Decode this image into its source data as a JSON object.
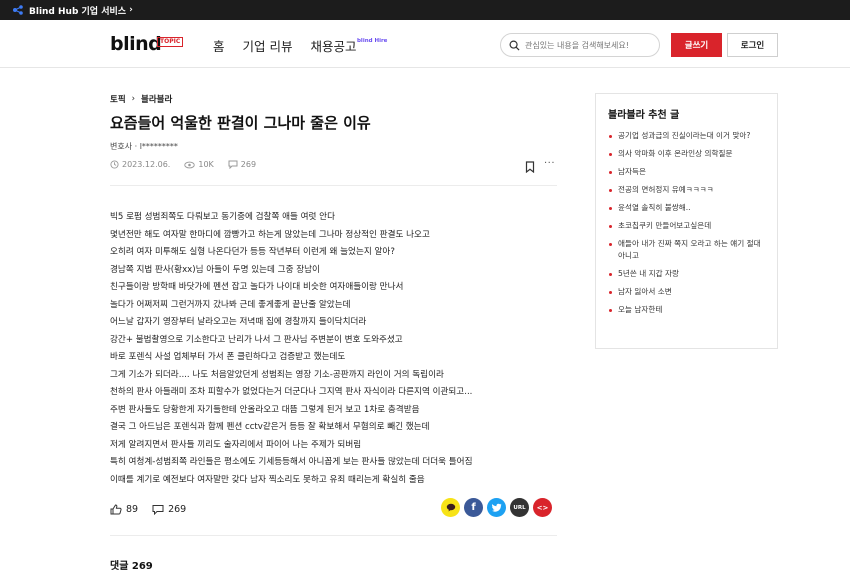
{
  "topbar": {
    "label": "Blind Hub 기업 서비스",
    "chevron": "›"
  },
  "header": {
    "logo": "blind",
    "logo_badge": "TOPIC",
    "nav": [
      "홈",
      "기업 리뷰",
      "채용공고"
    ],
    "nav_hire_badge": "blind Hire",
    "search_placeholder": "관심있는 내용을 검색해보세요!",
    "write_label": "글쓰기",
    "login_label": "로그인"
  },
  "post": {
    "breadcrumb": [
      "토픽",
      "블라블라"
    ],
    "title": "요즘들어 억울한 판결이 그나마 줄은 이유",
    "author": "변호사 · l*********",
    "date": "2023.12.06.",
    "views": "10K",
    "comments_count": "269",
    "lines": [
      "빅5 로펌 성범죄쪽도 다뤄보고 동기중에 검찰쪽 애들 여럿 안다",
      "몇년전만 해도 여자말 한마디에 깜빵가고 하는게 많았는데 그나마 정상적인 판결도 나오고",
      "오히려 여자 미투해도 실형 나온다던가 등등 작년부터 이런게 왜 늘었는지 알아?",
      "경남쪽 지법 판사(황xx)님 아들이 두명 있는데 그중 장남이",
      "친구들이랑 방학때 바닷가에 펜션 잡고 놀다가 나이대 비슷한 여자애들이랑 만나서",
      "놀다가 어쩌저찌 그런거까지 갔나봐 근데 좋게좋게 끝난줄 알았는데",
      "어느날 갑자기 영장부터 날라오고는 저녁때 집에 경찰까지 들이닥치더라",
      "강간+ 불법촬영으로 기소한다고 난리가 나서 그 판사님 주변분이 변호 도와주셨고",
      "바로 포렌식 사설 업체부터 가서 폰 클린하다고 검증받고 했는데도",
      "그게 기소가 되더라.... 나도 처음알았던게 성범죄는 영장 기소-공판까지 라인이 거의 독립이라",
      "천하의 판사 아들래미 조차 피할수가 없었다는거 더군다나 그지역 판사 자식이라 다른지역 이관되고...",
      "주변 판사들도 당황한게 자기들한테 안올라오고 대뜸 그렇게 된거 보고 1차로 충격받음",
      "결국 그 아드님은 포렌식과 함께 펜션 cctv같은거 등등 잘 확보해서 무혐의로 빼긴 했는데",
      "저게 알려지면서 판사들 끼리도 술자리에서 파이어 나는 주제가 되버림",
      "특히 여청계-성범죄쪽 라인들은 평소에도 기세등등해서 아니꼽게 보는 판사들 많았는데 더더욱 틀어짐",
      "이때를 계기로 예전보다 여자말만 갖다 남자 찍소리도 못하고 유죄 때리는게 확실히 줄음"
    ],
    "likes": "89",
    "comment_reactions": "269",
    "comments_header": "댓글 269"
  },
  "share": [
    {
      "name": "kakao",
      "label": "",
      "color": "#f7e317"
    },
    {
      "name": "facebook",
      "label": "f",
      "color": "#3b5998"
    },
    {
      "name": "twitter",
      "label": "",
      "color": "#1da1f2"
    },
    {
      "name": "url",
      "label": "URL",
      "color": "#333333"
    },
    {
      "name": "embed",
      "label": "<>",
      "color": "#d9242b"
    }
  ],
  "sidebar": {
    "title": "블라블라 추천 글",
    "items": [
      "공기업 성과급의 진실이라는대 이거 맞아?",
      "의사 악마화 이후 온라인상 의학질문",
      "남자득은",
      "전공의 면허정지 유예ㅋㅋㅋㅋ",
      "윤석열 솔직히 불쌍해..",
      "초코칩쿠키 만들어보고싶은데",
      "애들아 내가 진짜 쪽지 오라고 하는 얘기 절대 아니고",
      "5년쓴 내 지갑 자랑",
      "남자 잃아서 소변",
      "오늘 남자한테"
    ]
  }
}
